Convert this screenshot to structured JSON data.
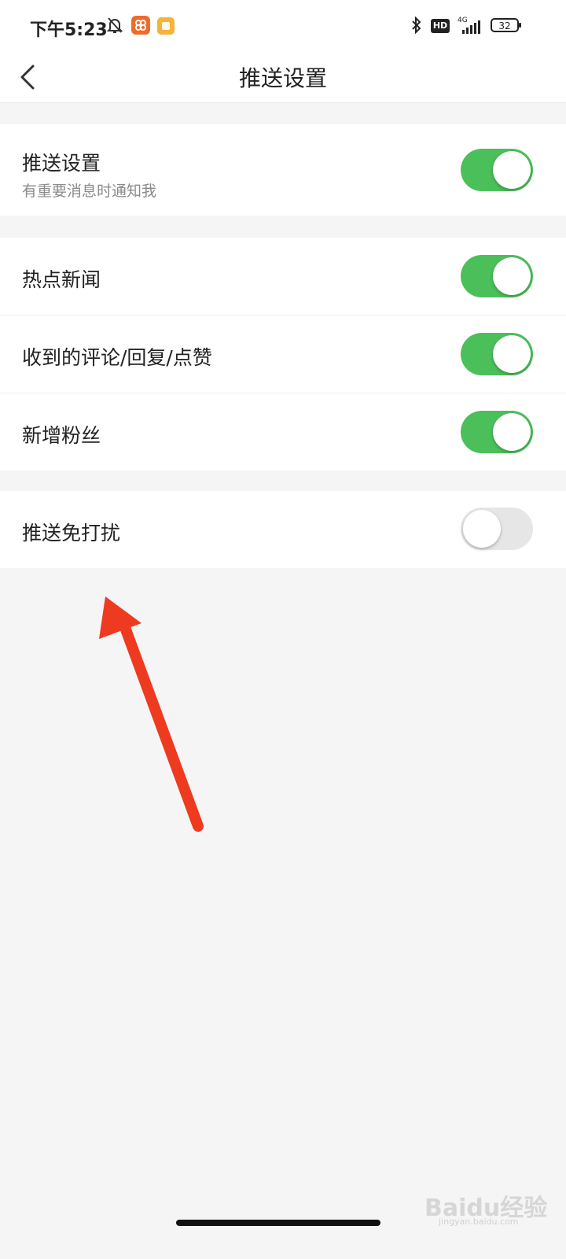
{
  "status_bar": {
    "time": "下午5:23",
    "hd_label": "HD",
    "network": "4G",
    "battery": "32",
    "icons": [
      "bell-off-icon",
      "app-icon",
      "notes-app-icon",
      "bluetooth-icon",
      "hd-icon",
      "signal-icon",
      "battery-icon"
    ]
  },
  "nav": {
    "title": "推送设置",
    "back_icon": "chevron-left-icon"
  },
  "sections": [
    {
      "items": [
        {
          "label": "推送设置",
          "sub": "有重要消息时通知我",
          "enabled": true
        }
      ]
    },
    {
      "items": [
        {
          "label": "热点新闻",
          "enabled": true
        },
        {
          "label": "收到的评论/回复/点赞",
          "enabled": true
        },
        {
          "label": "新增粉丝",
          "enabled": true
        }
      ]
    },
    {
      "items": [
        {
          "label": "推送免打扰",
          "enabled": false
        }
      ]
    }
  ],
  "colors": {
    "toggle_on": "#4bc05a",
    "toggle_off": "#e6e6e6",
    "annotation_arrow": "#ee3a1f"
  },
  "watermark": {
    "text": "Baidu经验",
    "url": "jingyan.baidu.com"
  }
}
